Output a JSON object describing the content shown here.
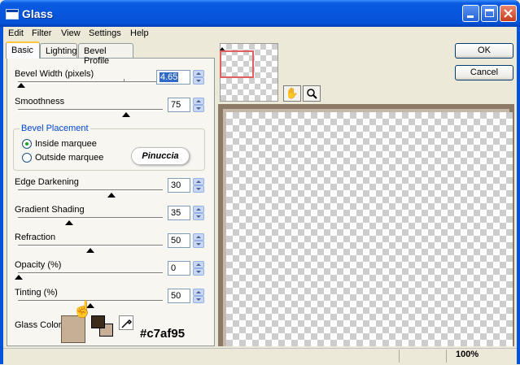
{
  "window": {
    "title": "Glass"
  },
  "menu": [
    "Edit",
    "Filter",
    "View",
    "Settings",
    "Help"
  ],
  "tabs": [
    "Basic",
    "Lighting",
    "Bevel Profile"
  ],
  "controls": {
    "bevel_width": {
      "label": "Bevel Width (pixels)",
      "value": "4.65"
    },
    "smoothness": {
      "label": "Smoothness",
      "value": "75"
    },
    "bevel_placement": {
      "title": "Bevel Placement",
      "inside": "Inside marquee",
      "outside": "Outside marquee",
      "selected": "inside"
    },
    "edge_darkening": {
      "label": "Edge Darkening",
      "value": "30"
    },
    "gradient_shading": {
      "label": "Gradient Shading",
      "value": "35"
    },
    "refraction": {
      "label": "Refraction",
      "value": "50"
    },
    "opacity": {
      "label": "Opacity (%)",
      "value": "0"
    },
    "tinting": {
      "label": "Tinting (%)",
      "value": "50"
    },
    "glass_color": {
      "label": "Glass Color",
      "hex": "#c7af95"
    }
  },
  "watermark": "Pinuccia",
  "buttons": {
    "ok": "OK",
    "cancel": "Cancel"
  },
  "status": {
    "zoom": "100%"
  },
  "colors": {
    "glass": "#c7af95",
    "foreground": "#3b2c1c",
    "title_bar": "#0856dd"
  },
  "icons": {
    "pan": "hand-icon",
    "zoom": "magnifier-icon",
    "pick": "eyedropper-icon"
  }
}
